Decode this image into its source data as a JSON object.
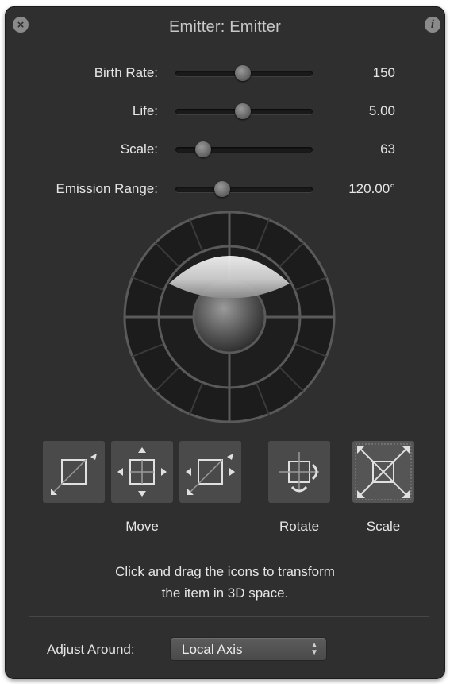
{
  "window": {
    "title": "Emitter: Emitter",
    "close_icon": "close-icon",
    "info_icon": "info-icon"
  },
  "params": [
    {
      "label": "Birth Rate:",
      "value": "150",
      "fraction": 0.49
    },
    {
      "label": "Life:",
      "value": "5.00",
      "fraction": 0.49
    },
    {
      "label": "Scale:",
      "value": "63",
      "fraction": 0.2
    },
    {
      "label": "Emission Range:",
      "value": "120.00°",
      "fraction": 0.34
    }
  ],
  "transform": {
    "move_label": "Move",
    "rotate_label": "Rotate",
    "scale_label": "Scale",
    "icons": [
      "move-xy-icon",
      "move-xyz-icon",
      "move-z-icon",
      "rotate-icon",
      "scale-icon"
    ]
  },
  "help": {
    "line1": "Click and drag the icons to transform",
    "line2": "the item in 3D space."
  },
  "adjust": {
    "label": "Adjust Around:",
    "value": "Local Axis"
  },
  "colors": {
    "panel": "#2f2f2f",
    "text": "#e6e6e6"
  }
}
